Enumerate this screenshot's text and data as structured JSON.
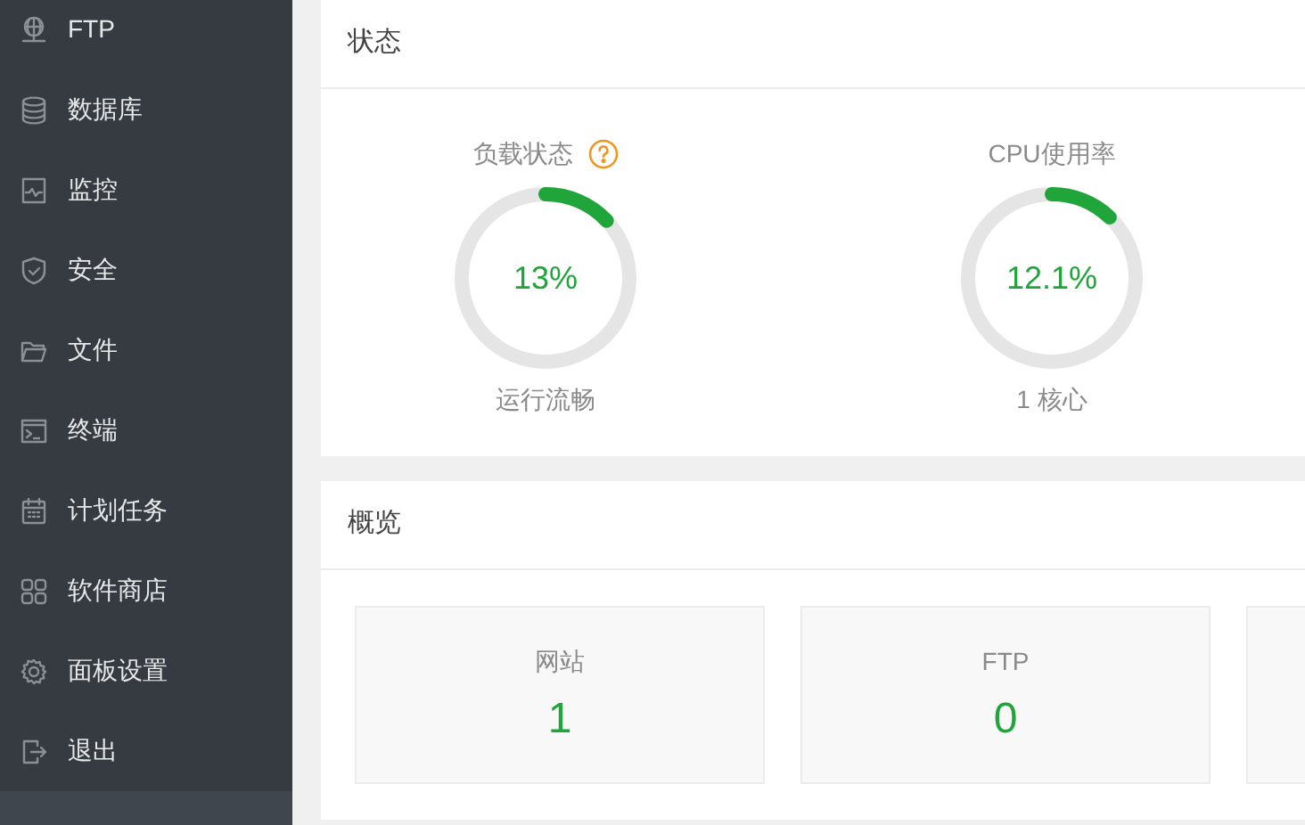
{
  "sidebar": {
    "items": [
      {
        "label": "FTP",
        "kind": "globe"
      },
      {
        "label": "数据库",
        "kind": "database"
      },
      {
        "label": "监控",
        "kind": "monitor"
      },
      {
        "label": "安全",
        "kind": "shield"
      },
      {
        "label": "文件",
        "kind": "folder"
      },
      {
        "label": "终端",
        "kind": "terminal"
      },
      {
        "label": "计划任务",
        "kind": "calendar"
      },
      {
        "label": "软件商店",
        "kind": "grid"
      },
      {
        "label": "面板设置",
        "kind": "gear"
      },
      {
        "label": "退出",
        "kind": "logout"
      }
    ]
  },
  "status": {
    "title": "状态",
    "gauges": [
      {
        "title": "负载状态",
        "help": true,
        "value": "13%",
        "level": 0.13,
        "caption": "运行流畅"
      },
      {
        "title": "CPU使用率",
        "help": false,
        "value": "12.1%",
        "level": 0.121,
        "caption": "1 核心"
      }
    ]
  },
  "overview": {
    "title": "概览",
    "cards": [
      {
        "kind": "stat",
        "label": "网站",
        "value": "1"
      },
      {
        "kind": "stat",
        "label": "FTP",
        "value": "0"
      },
      {
        "kind": "blank"
      }
    ]
  }
}
